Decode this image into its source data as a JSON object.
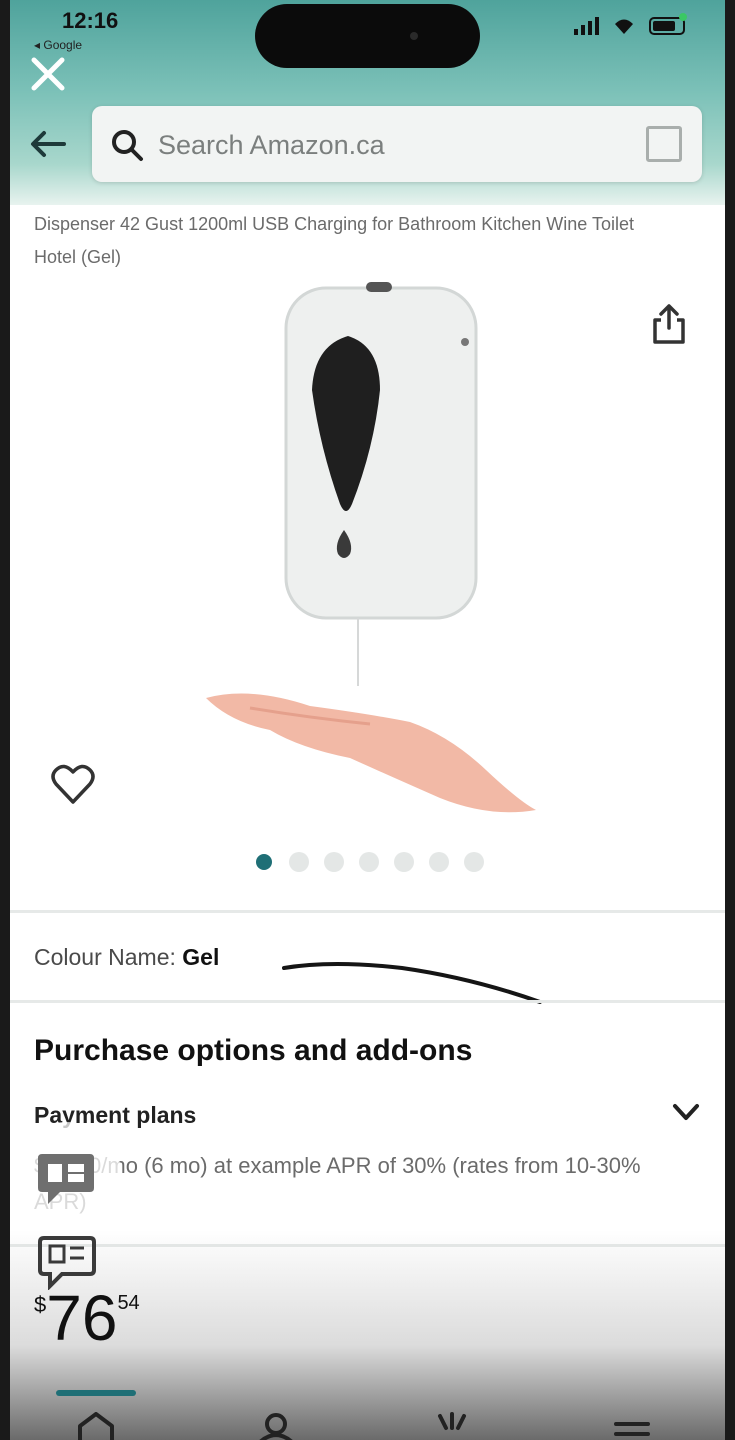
{
  "status_bar": {
    "time": "12:16",
    "carrier": "◂ Google"
  },
  "header": {
    "close_icon": "close-icon",
    "back_icon": "arrow-left-icon",
    "search_placeholder": "Search Amazon.ca",
    "scan_icon": "barcode-scan-icon"
  },
  "product": {
    "title": "Dispenser 42 Gust 1200ml USB Charging for Bathroom Kitchen Wine Toilet Hotel (Gel)",
    "image_count": 7,
    "active_image": 1,
    "colour_label": "Colour Name:",
    "colour_value": "Gel"
  },
  "purchase": {
    "heading": "Purchase options and add-ons",
    "payment_plans_label": "Payment plans",
    "payment_detail": "$13.00/mo (6 mo) at example APR of 30% (rates from 10-30% APR)"
  },
  "price": {
    "currency": "$",
    "whole": "76",
    "fraction": "54"
  },
  "colors": {
    "accent": "#1f6f76",
    "header_top": "#4fa39c"
  }
}
